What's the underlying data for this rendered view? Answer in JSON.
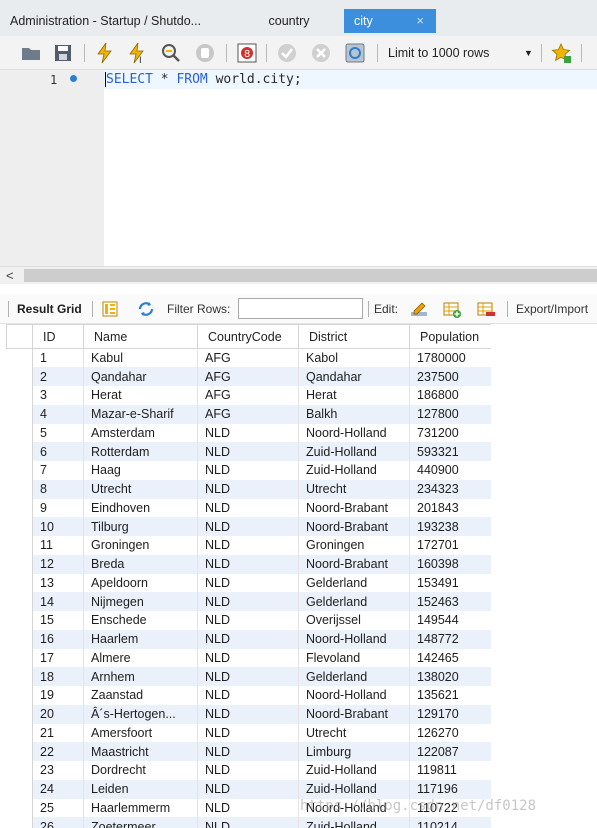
{
  "tabs": [
    {
      "label": "Administration - Startup / Shutdo..."
    },
    {
      "label": "country"
    },
    {
      "label": "city",
      "close": "×"
    }
  ],
  "toolbar": {
    "limit_label": "Limit to 1000 rows",
    "icons": [
      "folder-icon",
      "save-icon",
      "execute-icon",
      "execute-current-icon",
      "explain-icon",
      "stop-icon",
      "toggle-error-icon",
      "commit-icon",
      "rollback-icon",
      "autocommit-icon",
      "dropdown-icon",
      "bookmark-icon"
    ]
  },
  "editor": {
    "line_number": "1",
    "query_keyword_select": "SELECT",
    "query_star": " * ",
    "query_keyword_from": "FROM",
    "query_rest": " world.city;"
  },
  "result_toolbar": {
    "title": "Result Grid",
    "filter_label": "Filter Rows:",
    "filter_value": "",
    "edit_label": "Edit:",
    "export_label": "Export/Import"
  },
  "grid": {
    "columns": [
      "ID",
      "Name",
      "CountryCode",
      "District",
      "Population"
    ],
    "rows": [
      [
        "1",
        "Kabul",
        "AFG",
        "Kabol",
        "1780000"
      ],
      [
        "2",
        "Qandahar",
        "AFG",
        "Qandahar",
        "237500"
      ],
      [
        "3",
        "Herat",
        "AFG",
        "Herat",
        "186800"
      ],
      [
        "4",
        "Mazar-e-Sharif",
        "AFG",
        "Balkh",
        "127800"
      ],
      [
        "5",
        "Amsterdam",
        "NLD",
        "Noord-Holland",
        "731200"
      ],
      [
        "6",
        "Rotterdam",
        "NLD",
        "Zuid-Holland",
        "593321"
      ],
      [
        "7",
        "Haag",
        "NLD",
        "Zuid-Holland",
        "440900"
      ],
      [
        "8",
        "Utrecht",
        "NLD",
        "Utrecht",
        "234323"
      ],
      [
        "9",
        "Eindhoven",
        "NLD",
        "Noord-Brabant",
        "201843"
      ],
      [
        "10",
        "Tilburg",
        "NLD",
        "Noord-Brabant",
        "193238"
      ],
      [
        "11",
        "Groningen",
        "NLD",
        "Groningen",
        "172701"
      ],
      [
        "12",
        "Breda",
        "NLD",
        "Noord-Brabant",
        "160398"
      ],
      [
        "13",
        "Apeldoorn",
        "NLD",
        "Gelderland",
        "153491"
      ],
      [
        "14",
        "Nijmegen",
        "NLD",
        "Gelderland",
        "152463"
      ],
      [
        "15",
        "Enschede",
        "NLD",
        "Overijssel",
        "149544"
      ],
      [
        "16",
        "Haarlem",
        "NLD",
        "Noord-Holland",
        "148772"
      ],
      [
        "17",
        "Almere",
        "NLD",
        "Flevoland",
        "142465"
      ],
      [
        "18",
        "Arnhem",
        "NLD",
        "Gelderland",
        "138020"
      ],
      [
        "19",
        "Zaanstad",
        "NLD",
        "Noord-Holland",
        "135621"
      ],
      [
        "20",
        "Â´s-Hertogen...",
        "NLD",
        "Noord-Brabant",
        "129170"
      ],
      [
        "21",
        "Amersfoort",
        "NLD",
        "Utrecht",
        "126270"
      ],
      [
        "22",
        "Maastricht",
        "NLD",
        "Limburg",
        "122087"
      ],
      [
        "23",
        "Dordrecht",
        "NLD",
        "Zuid-Holland",
        "119811"
      ],
      [
        "24",
        "Leiden",
        "NLD",
        "Zuid-Holland",
        "117196"
      ],
      [
        "25",
        "Haarlemmerm",
        "NLD",
        "Noord-Holland",
        "110722"
      ],
      [
        "26",
        "Zoetermeer",
        "NLD",
        "Zuid-Holland",
        "110214"
      ]
    ]
  },
  "watermark": "https://blog.csdn.net/df0128",
  "colors": {
    "accent": "#3b8fdc",
    "row_alt": "#eaf1fb",
    "keyword": "#2a62d4"
  }
}
